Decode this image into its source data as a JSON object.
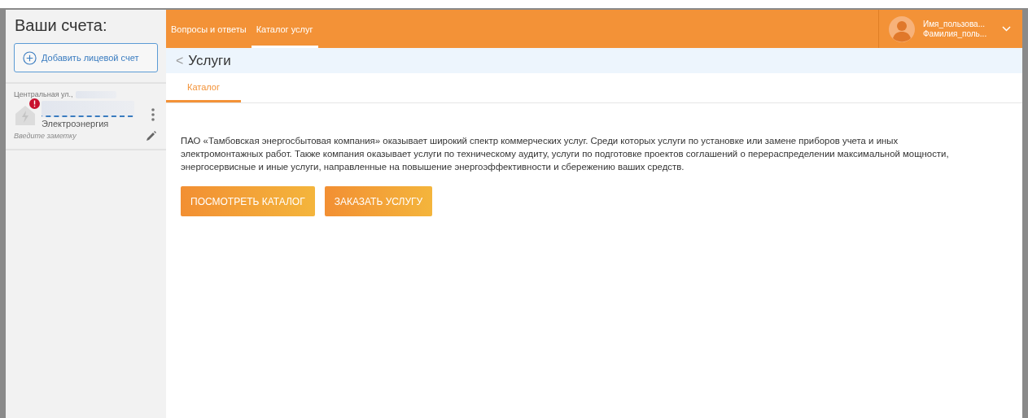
{
  "sidebar": {
    "title": "Ваши счета:",
    "add_button": "Добавить лицевой счет",
    "accounts": [
      {
        "address": "Центральная ул.,",
        "service": "Электроэнергия",
        "alert": true,
        "note": {
          "placeholder": "Введите заметку"
        }
      }
    ]
  },
  "header": {
    "nav": [
      {
        "label": "Вопросы и ответы",
        "selected": false
      },
      {
        "label": "Каталог услуг",
        "selected": true
      }
    ],
    "user": {
      "first_name": "Имя_пользова...",
      "last_name": "Фамилия_поль..."
    }
  },
  "page": {
    "back": "<",
    "title": "Услуги",
    "tabs": [
      {
        "label": "Каталог",
        "selected": true
      }
    ],
    "description": "ПАО «Тамбовская энергосбытовая компания» оказывает широкий спектр коммерческих услуг. Среди которых услуги по установке или замене приборов учета и иных электромонтажных работ. Также компания оказывает услуги по техническому аудиту, услуги по подготовке проектов соглашений о перераспределении максимальной мощности, энергосервисные и иные услуги, направленные на повышение энергоэффективности и сбережению ваших средств.",
    "buttons": [
      "ПОСМОТРЕТЬ КАТАЛОГ",
      "ЗАКАЗАТЬ УСЛУГУ"
    ]
  }
}
